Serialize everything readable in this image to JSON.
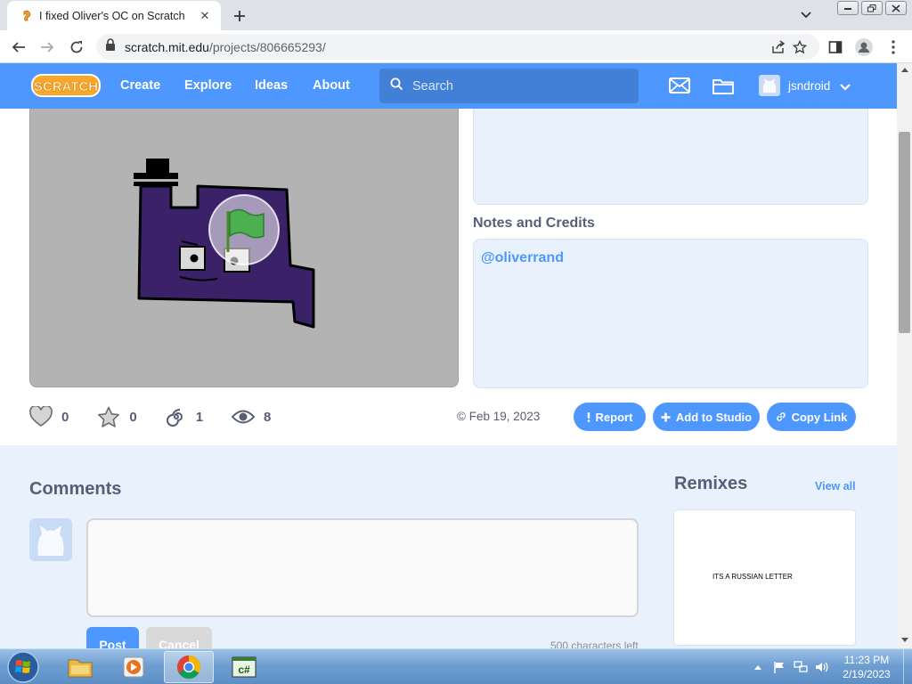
{
  "browser": {
    "tab_title": "I fixed Oliver's OC on Scratch",
    "url_host": "scratch.mit.edu",
    "url_path": "/projects/806665293/",
    "icons": [
      "scratch-favicon",
      "close-icon",
      "plus-icon",
      "chevron-down-icon",
      "back-icon",
      "forward-icon",
      "reload-icon",
      "lock-icon",
      "share-icon",
      "star-icon",
      "side-panel-icon",
      "profile-icon",
      "kebab-menu-icon"
    ]
  },
  "header": {
    "logo_text": "SCRATCH",
    "nav": {
      "create": "Create",
      "explore": "Explore",
      "ideas": "Ideas",
      "about": "About"
    },
    "search_placeholder": "Search",
    "username": "jsndroid",
    "icons": [
      "search-icon",
      "messages-icon",
      "my-stuff-icon",
      "avatar",
      "chevron-down-icon"
    ]
  },
  "project": {
    "notes_title": "Notes and Credits",
    "notes_text": "@oliverrand",
    "stats": {
      "loves": "0",
      "favorites": "0",
      "remixes": "1",
      "views": "8"
    },
    "date": "© Feb 19, 2023",
    "buttons": {
      "report": "Report",
      "add_to_studio": "Add to Studio",
      "copy_link": "Copy Link"
    },
    "colors": {
      "accent": "#4d97ff",
      "stage_bg": "#b3b3b3",
      "character": "#3a2168",
      "flag": "#4caf50"
    }
  },
  "comments": {
    "title": "Comments",
    "post": "Post",
    "cancel": "Cancel",
    "chars_left": "500 characters left"
  },
  "remixes": {
    "title": "Remixes",
    "view_all": "View all",
    "card_text": "ITS A RUSSIAN LETTER"
  },
  "taskbar": {
    "time": "11:23 PM",
    "date": "2/19/2023",
    "apps": [
      "windows-explorer",
      "media-player",
      "google-chrome",
      "csharp-app"
    ],
    "tray_icons": [
      "show-hidden-icons",
      "action-center-flag-icon",
      "network-icon",
      "volume-icon"
    ]
  }
}
